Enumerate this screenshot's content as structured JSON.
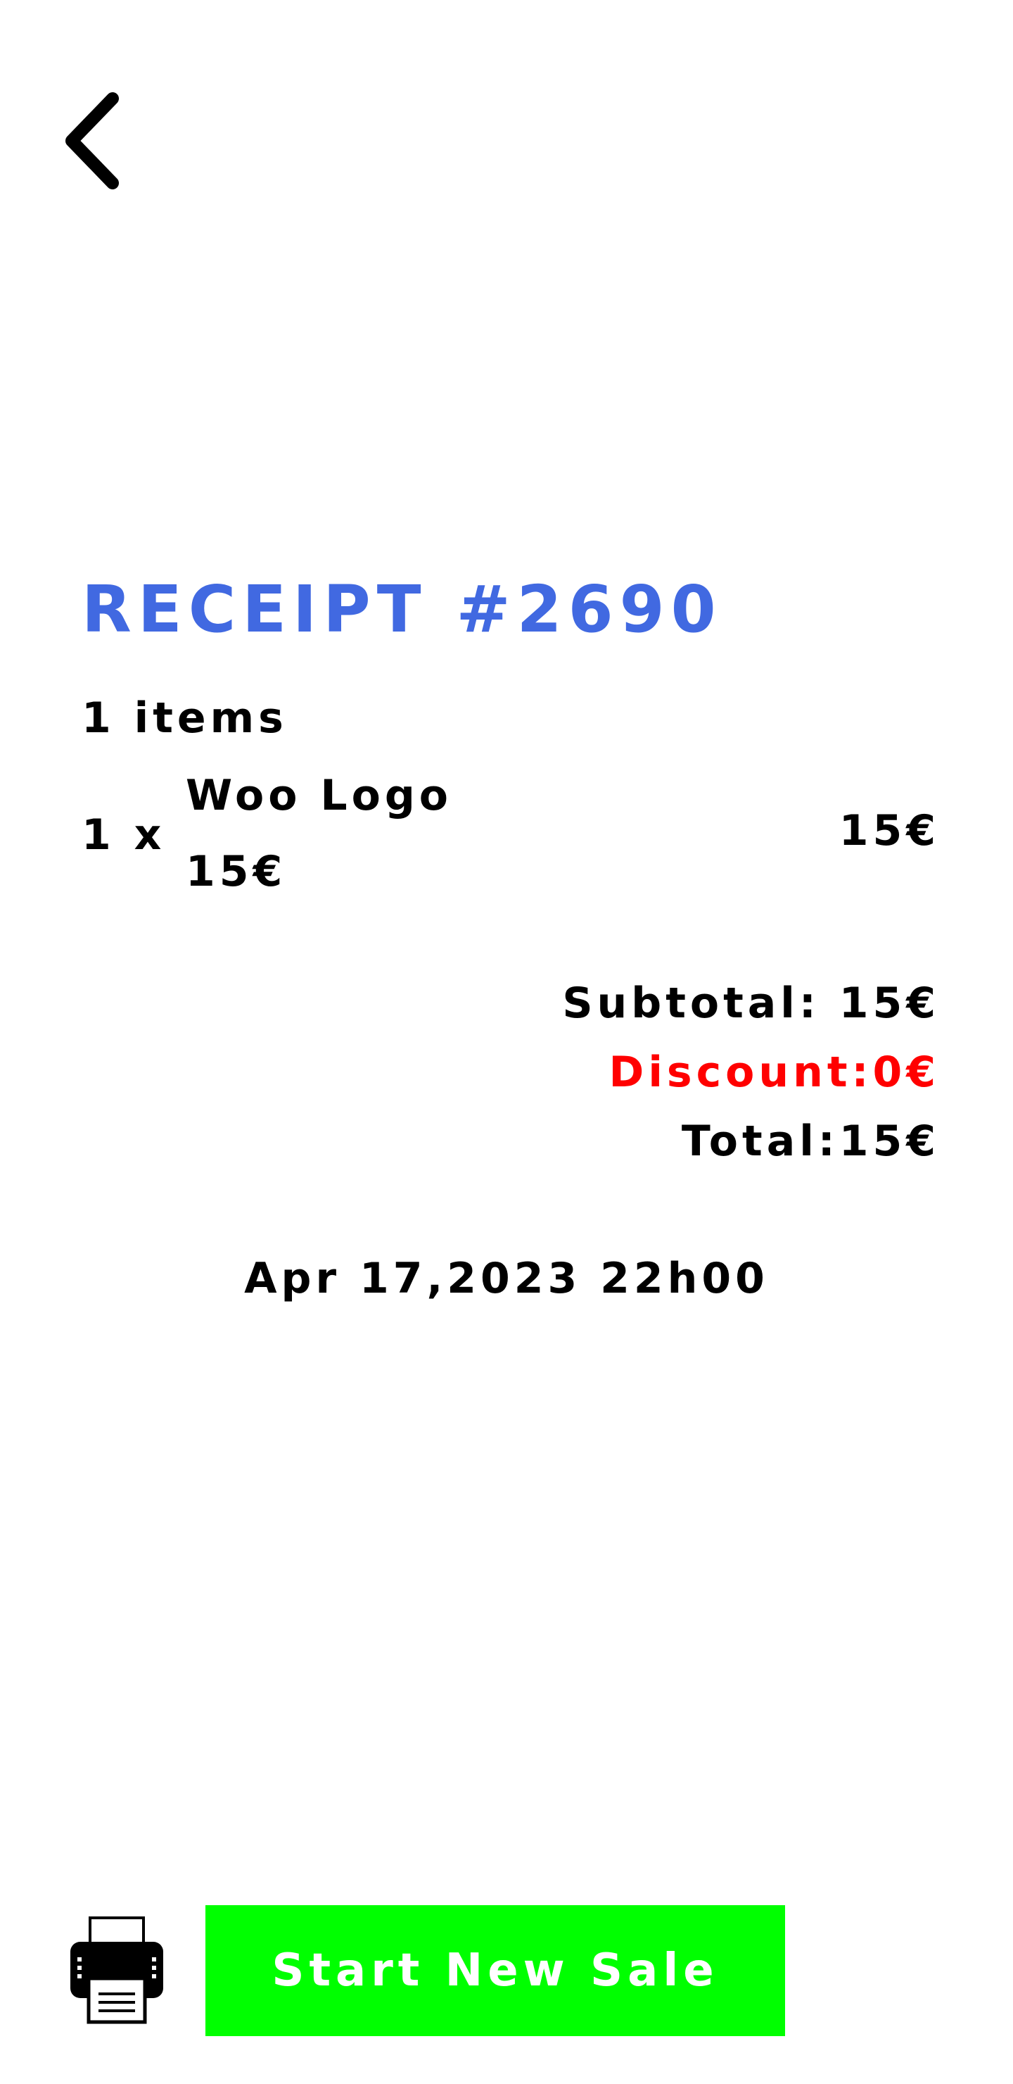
{
  "header": {
    "back_icon": "chevron-left-icon"
  },
  "receipt": {
    "title": "RECEIPT #2690",
    "title_color": "#4169e1",
    "items_count": "1 items",
    "line_items": [
      {
        "qty": "1 x",
        "name": "Woo Logo",
        "unit_price": "15€",
        "line_total": "15€"
      }
    ],
    "subtotal": "Subtotal: 15€",
    "discount": "Discount:0€",
    "discount_color": "#ff0000",
    "total": "Total:15€",
    "date": "Apr 17,2023 22h00"
  },
  "footer": {
    "print_icon": "printer-icon",
    "start_new_sale_label": "Start New Sale",
    "start_button_color": "#00ff00"
  }
}
